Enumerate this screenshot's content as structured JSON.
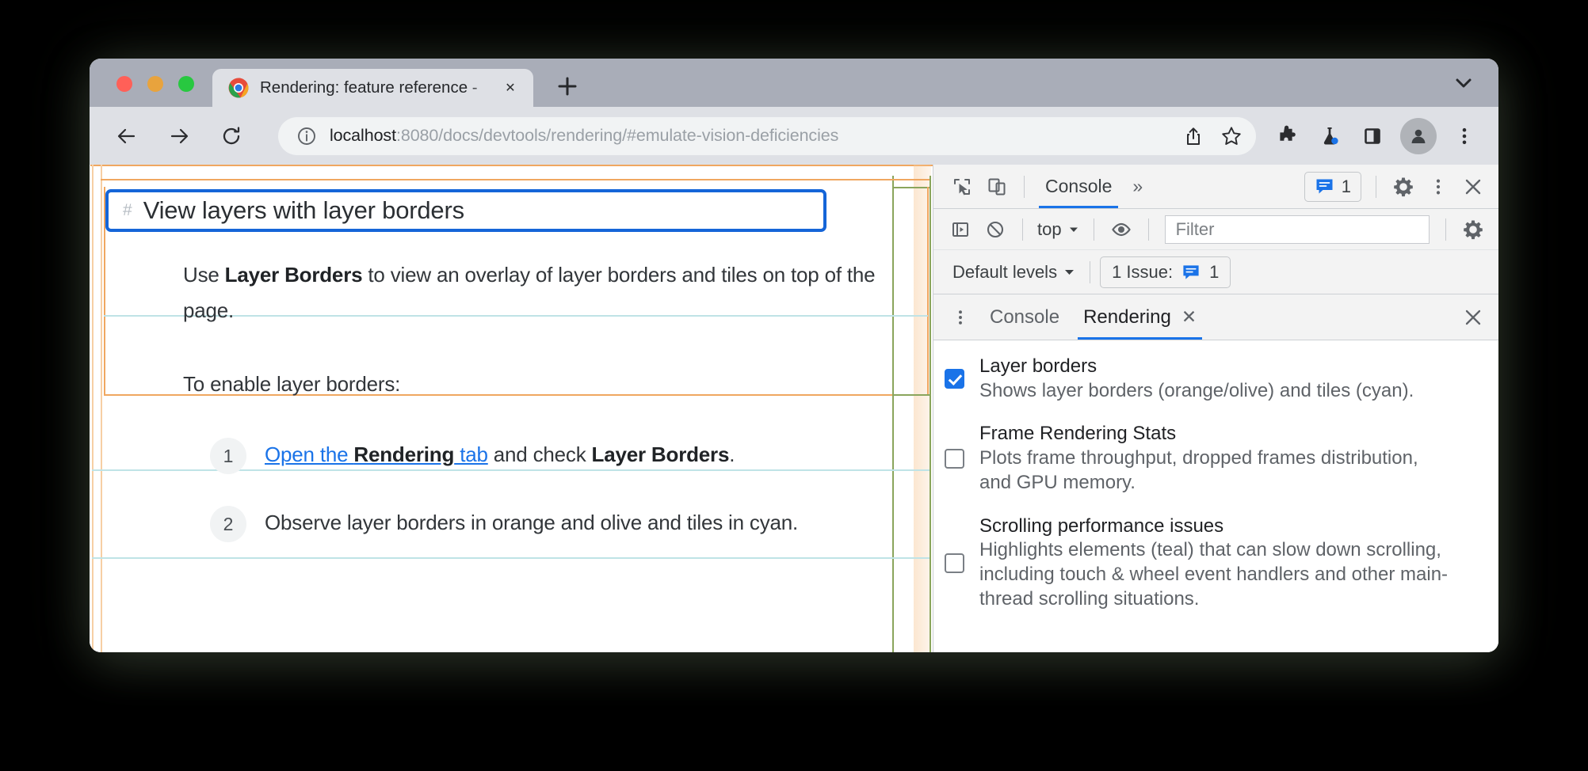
{
  "window": {
    "traffic_lights": [
      "close",
      "minimize",
      "maximize"
    ],
    "tab": {
      "title": "Rendering: feature reference -",
      "favicon": "chrome-logo-icon",
      "close_label": "✕"
    },
    "new_tab_label": "+",
    "tab_search_label": "⌵"
  },
  "toolbar": {
    "back_label": "←",
    "forward_label": "→",
    "reload_label": "⟳",
    "url_host": "localhost",
    "url_rest": ":8080/docs/devtools/rendering/#emulate-vision-deficiencies",
    "icons": [
      "info-icon",
      "share-icon",
      "bookmark-star-icon",
      "extensions-puzzle-icon",
      "experiments-flask-icon",
      "side-panel-icon",
      "profile-avatar-icon",
      "chrome-menu-icon"
    ]
  },
  "page": {
    "heading": {
      "anchor": "#",
      "text": "View layers with layer borders"
    },
    "paragraph1": {
      "lead": "Use ",
      "bold": "Layer Borders",
      "rest": " to view an overlay of layer borders and tiles on top of the page."
    },
    "paragraph2": "To enable layer borders:",
    "list": [
      {
        "num": "1",
        "link_pre": "Open the ",
        "link_bold": "Rendering",
        "link_post": " tab",
        "after": " and check ",
        "bold2": "Layer Borders",
        "tail": "."
      },
      {
        "num": "2",
        "text": "Observe layer borders in orange and olive and tiles in cyan."
      }
    ],
    "overlay_colors": {
      "layer_border_orange": "#f0a760",
      "layer_border_olive": "#8aa55c",
      "tile_cyan": "#bfe3e6",
      "focus_blue": "#1565d8"
    }
  },
  "devtools": {
    "main_toolbar": {
      "inspect_icon": "inspect-element-icon",
      "device_icon": "device-toolbar-icon",
      "active_tab": "Console",
      "more_tabs_label": "»",
      "issues_count": "1",
      "settings_icon": "gear-icon",
      "menu_icon": "three-dot-menu-icon",
      "close_icon": "close-icon"
    },
    "console_toolbar": {
      "sidebar_icon": "console-sidebar-icon",
      "clear_icon": "clear-console-icon",
      "context_selector": "top",
      "eye_icon": "live-expression-eye-icon",
      "filter_placeholder": "Filter",
      "settings_icon": "gear-icon"
    },
    "filter_row": {
      "levels": "Default levels",
      "issue_text": "1 Issue:",
      "issue_count": "1"
    },
    "drawer": {
      "menu_icon": "three-dot-menu-icon",
      "tabs": [
        {
          "label": "Console",
          "active": false,
          "closable": false
        },
        {
          "label": "Rendering",
          "active": true,
          "closable": true,
          "close_label": "✕"
        }
      ],
      "close_label": "✕"
    },
    "rendering_options": [
      {
        "title": "Layer borders",
        "desc": "Shows layer borders (orange/olive) and tiles (cyan).",
        "checked": true
      },
      {
        "title": "Frame Rendering Stats",
        "desc": "Plots frame throughput, dropped frames distribution, and GPU memory.",
        "checked": false
      },
      {
        "title": "Scrolling performance issues",
        "desc": "Highlights elements (teal) that can slow down scrolling, including touch & wheel event handlers and other main-thread scrolling situations.",
        "checked": false
      }
    ]
  }
}
